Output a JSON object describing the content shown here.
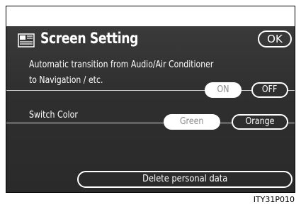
{
  "header": {
    "title": "Screen Setting",
    "icon": "screen-setting-icon",
    "ok_label": "OK"
  },
  "auto_transition": {
    "description_line1": "Automatic transition from Audio/Air Conditioner",
    "description_line2": "to Navigation / etc.",
    "options": [
      "ON",
      "OFF"
    ],
    "selected": "ON"
  },
  "switch_color": {
    "label": "Switch Color",
    "options": [
      "Green",
      "Orange"
    ],
    "selected": "Green"
  },
  "delete_label": "Delete personal data",
  "image_code": "ITY31P010",
  "colors": {
    "screen_bg": "#333333",
    "text": "#ffffff",
    "selected_bg": "#ffffff",
    "selected_text": "#8a8a8a"
  }
}
